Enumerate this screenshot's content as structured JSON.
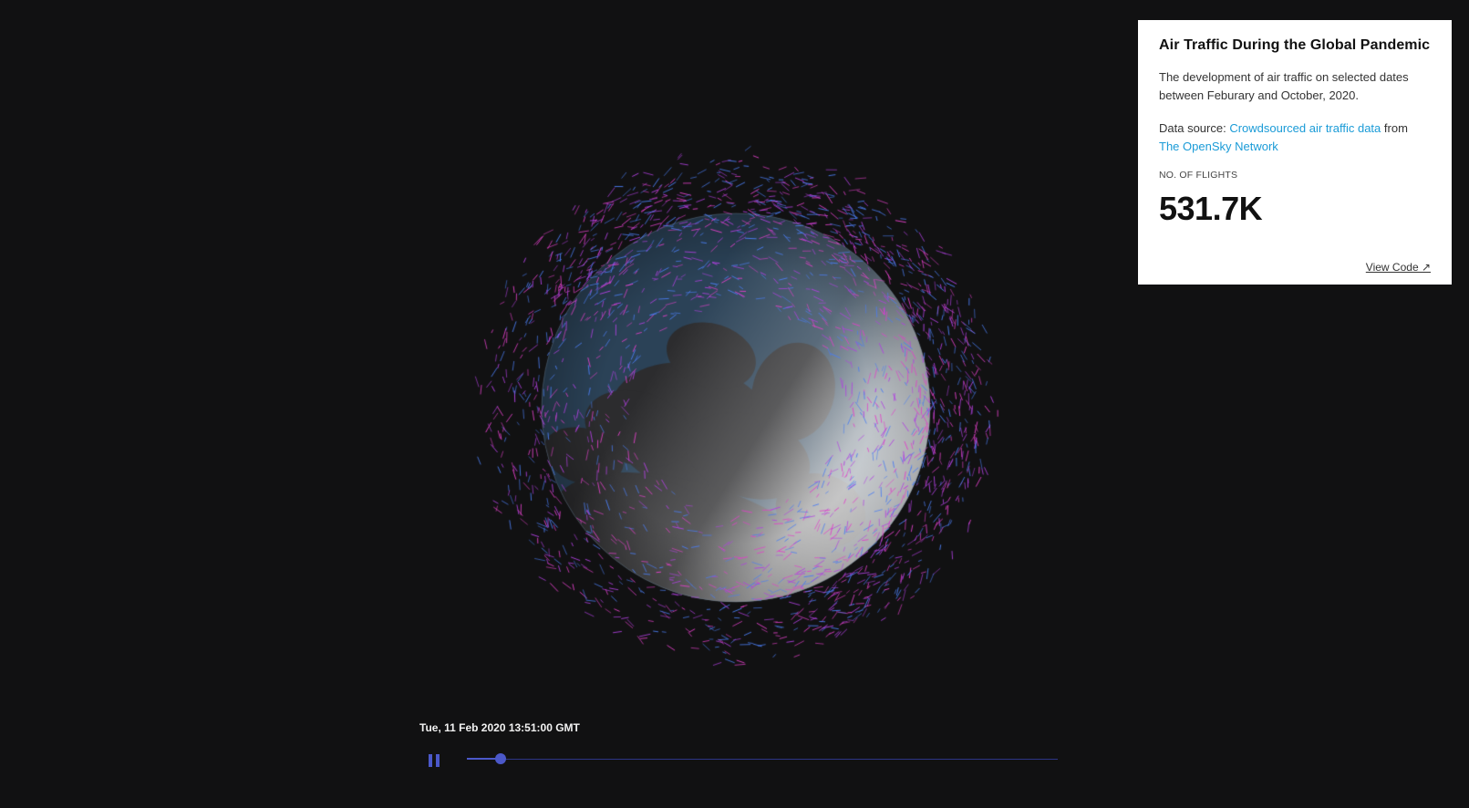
{
  "info_panel": {
    "title": "Air Traffic During the Global Pandemic",
    "description": "The development of air traffic on selected dates between Feburary and October, 2020.",
    "source_prefix": "Data source: ",
    "source_link_1": "Crowdsourced air traffic data",
    "source_middle": " from",
    "source_link_2": "The OpenSky Network",
    "flights_label": "NO. OF FLIGHTS",
    "flights_value": "531.7K",
    "view_code": "View Code ↗",
    "link_color": "#1a9bd7"
  },
  "timeline": {
    "timestamp": "Tue, 11 Feb 2020 13:51:00 GMT",
    "play_state_icon": "pause-icon",
    "progress_fraction": 0.057,
    "accent_color": "#4b58c9"
  },
  "globe": {
    "background_color": "#111112",
    "ocean_color": "#2b4257",
    "land_color": "#2c2c2e",
    "flight_colors": [
      "#e040c8",
      "#4a7cf0",
      "#b040e0"
    ]
  }
}
